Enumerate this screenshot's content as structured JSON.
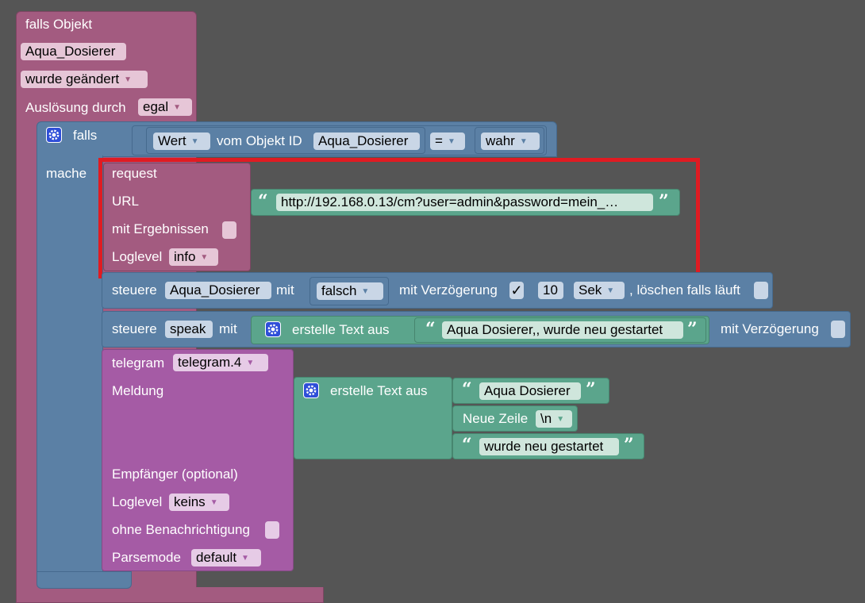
{
  "event": {
    "title": "falls Objekt",
    "object_id": "Aqua_Dosierer",
    "condition": "wurde geändert",
    "trigger_label": "Auslösung durch",
    "trigger_value": "egal"
  },
  "if_block": {
    "label": "falls",
    "do_label": "mache",
    "value_field": "Wert",
    "from_label": "vom Objekt ID",
    "object_id": "Aqua_Dosierer",
    "operator": "=",
    "compare_value": "wahr"
  },
  "request": {
    "title": "request",
    "url_label": "URL",
    "url_value": "http://192.168.0.13/cm?user=admin&password=mein_…",
    "results_label": "mit Ergebnissen",
    "loglevel_label": "Loglevel",
    "loglevel_value": "info"
  },
  "control1": {
    "label": "steuere",
    "object_id": "Aqua_Dosierer",
    "with_label": "mit",
    "value": "falsch",
    "delay_label": "mit Verzögerung",
    "delay_check": "✓",
    "delay_amount": "10",
    "unit": "Sek",
    "clear_label": ", löschen falls läuft"
  },
  "control2": {
    "label": "steuere",
    "object_id": "speak",
    "with_label": "mit",
    "create_text_label": "erstelle Text aus",
    "text_value": "Aqua Dosierer,, wurde neu gestartet",
    "delay_label": "mit Verzögerung"
  },
  "telegram": {
    "label": "telegram",
    "instance": "telegram.4",
    "message_label": "Meldung",
    "create_text_label": "erstelle Text aus",
    "text1": "Aqua Dosierer",
    "newline_label": "Neue Zeile",
    "newline_value": "\\n",
    "text2": "wurde neu gestartet",
    "recipient_label": "Empfänger (optional)",
    "loglevel_label": "Loglevel",
    "loglevel_value": "keins",
    "silent_label": "ohne Benachrichtigung",
    "parsemode_label": "Parsemode",
    "parsemode_value": "default"
  },
  "glyphs": {
    "open_quote": "“",
    "close_quote": "”",
    "dropdown": "▼"
  },
  "icons": [
    "gear-icon",
    "dropdown-arrow-icon",
    "checkbox-icon"
  ],
  "colors": {
    "workspace": "#555555",
    "event_block": "#a35b80",
    "logic_block": "#5b80a5",
    "telegram_block": "#a55ba5",
    "text_block": "#5ba58c",
    "highlight": "#e01b22"
  }
}
